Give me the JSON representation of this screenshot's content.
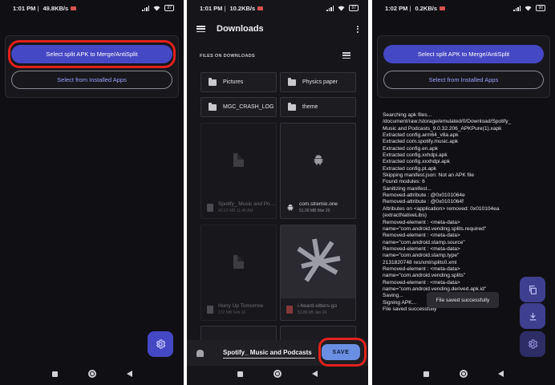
{
  "panel1": {
    "status": {
      "time": "1:01 PM",
      "speed": "49.8KB/s",
      "battery": "97"
    },
    "buttons": {
      "merge": "Select split APK to Merge/AntiSplit",
      "installed": "Select from Installed Apps"
    },
    "fab": "gear-icon"
  },
  "panel2": {
    "status": {
      "time": "1:01 PM",
      "speed": "10.2KB/s",
      "battery": "97"
    },
    "title": "Downloads",
    "section": "FILES ON DOWNLOADS",
    "folders": [
      "Pictures",
      "Physics paper",
      "MGC_CRASH_LOG",
      "theme"
    ],
    "files": [
      {
        "name": "Spotify_ Music and Podcasts",
        "size": "42.62 MB",
        "date": "11:48 AM"
      },
      {
        "name": "com.stremio.one",
        "size": "51.00 MB",
        "date": "Mar 20"
      },
      {
        "name": "Hurry Up Tomorrow",
        "size": "272 MB",
        "date": "Feb 16"
      },
      {
        "name": "i-heard-xitters-go",
        "size": "51.86 kB",
        "date": "Jan 24"
      }
    ],
    "filename_value": "Spotify_ Music and Podcasts",
    "save_label": "SAVE"
  },
  "panel3": {
    "status": {
      "time": "1:02 PM",
      "speed": "0.2KB/s",
      "battery": "96"
    },
    "buttons": {
      "merge": "Select split APK to Merge/AntiSplit",
      "installed": "Select from Installed Apps"
    },
    "log": [
      "Searching apk files...",
      "/document/raw:/storage/emulated/0/Download/Spotify_",
      "Music and Podcasts_9.0.32.206_APKPure(1).xapk",
      "Extracted config.arm64_v8a.apk",
      "Extracted com.spotify.music.apk",
      "Extracted config.en.apk",
      "Extracted config.xxhdpi.apk",
      "Extracted config.xxxhdpi.apk",
      "Extracted config.pt.apk",
      "Skipping manifest.json: Not an APK file",
      "Found modules: 6",
      "Sanitizing manifest...",
      "Removed-attribute : @0x0101064e",
      "Removed-attribute : @0x0101064f",
      "Attributes on <application> removed: 0x010104ea",
      "(extractNativeLibs)",
      "Removed-element : <meta-data>",
      "name=\"com.android.vending.splits.required\"",
      "Removed-element : <meta-data>",
      "name=\"com.android.stamp.source\"",
      "Removed-element : <meta-data>",
      "name=\"com.android.stamp.type\"",
      "2131820748 res/xml/splits0.xml",
      "Removed-element : <meta-data>",
      "name=\"com.android.vending.splits\"",
      "Removed-element : <meta-data>",
      "name=\"com.android.vending.derived.apk.id\"",
      "Saving...",
      "Signing APK...",
      "File saved successfully"
    ],
    "toast": "File saved successfully"
  }
}
